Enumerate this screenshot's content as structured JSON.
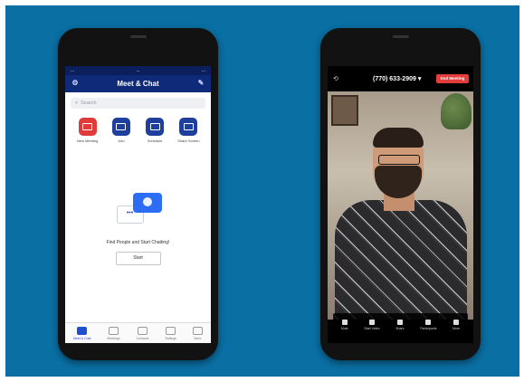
{
  "left_phone": {
    "status": {
      "left": "...",
      "time": "...",
      "right": "..."
    },
    "app_title": "Meet & Chat",
    "search_placeholder": "Search",
    "actions": [
      {
        "label": "New Meeting",
        "color": "#e03b3b"
      },
      {
        "label": "Join",
        "color": "#1f3f9c"
      },
      {
        "label": "Schedule",
        "color": "#1f3f9c"
      },
      {
        "label": "Share Screen",
        "color": "#1f3f9c"
      }
    ],
    "empty_state": {
      "bubble_text": "•••",
      "caption": "Find People and Start Chatting!",
      "button": "Start"
    },
    "tabs": [
      {
        "label": "Meet & Chat",
        "active": true
      },
      {
        "label": "Meetings",
        "active": false
      },
      {
        "label": "Contacts",
        "active": false
      },
      {
        "label": "Settings",
        "active": false
      },
      {
        "label": "More",
        "active": false
      }
    ]
  },
  "right_phone": {
    "call_number": "(770) 633-2909 ▾",
    "end_button": "End Meeting",
    "controls": [
      "Mute",
      "Start Video",
      "Share",
      "Participants",
      "More"
    ]
  }
}
